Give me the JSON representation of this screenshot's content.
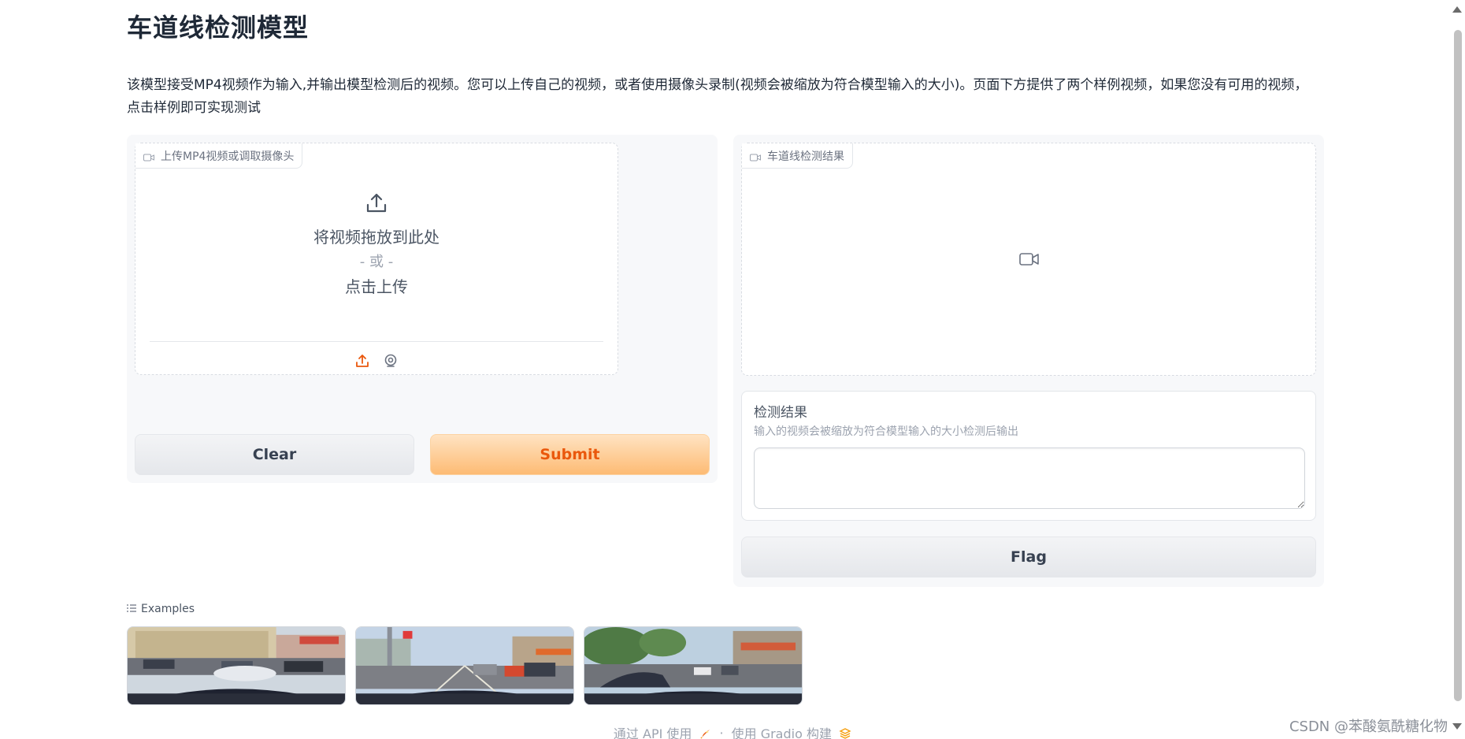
{
  "page": {
    "title": "车道线检测模型",
    "description": "该模型接受MP4视频作为输入,并输出模型检测后的视频。您可以上传自己的视频，或者使用摄像头录制(视频会被缩放为符合模型输入的大小)。页面下方提供了两个样例视频，如果您没有可用的视频，点击样例即可实现测试"
  },
  "input_video": {
    "label": "上传MP4视频或调取摄像头",
    "drop_text": "将视频拖放到此处",
    "or_text": "- 或 -",
    "click_text": "点击上传",
    "icon": "video-camera-icon"
  },
  "buttons": {
    "clear": "Clear",
    "submit": "Submit",
    "flag": "Flag"
  },
  "output_video": {
    "label": "车道线检测结果",
    "icon": "video-camera-icon"
  },
  "result_text": {
    "label": "检测结果",
    "info": "输入的视频会被缩放为符合模型输入的大小检测后输出",
    "value": ""
  },
  "examples": {
    "label": "Examples",
    "items": [
      "example-video-1",
      "example-video-2",
      "example-video-3"
    ]
  },
  "footer": {
    "api": "通过 API 使用",
    "separator": "·",
    "built_with": "使用 Gradio 构建"
  },
  "watermark": "CSDN @苯酸氨酰糖化物",
  "colors": {
    "accent": "#ea580c",
    "primary_bg": "#fdbb74",
    "panel_bg": "#f7f8fa"
  }
}
